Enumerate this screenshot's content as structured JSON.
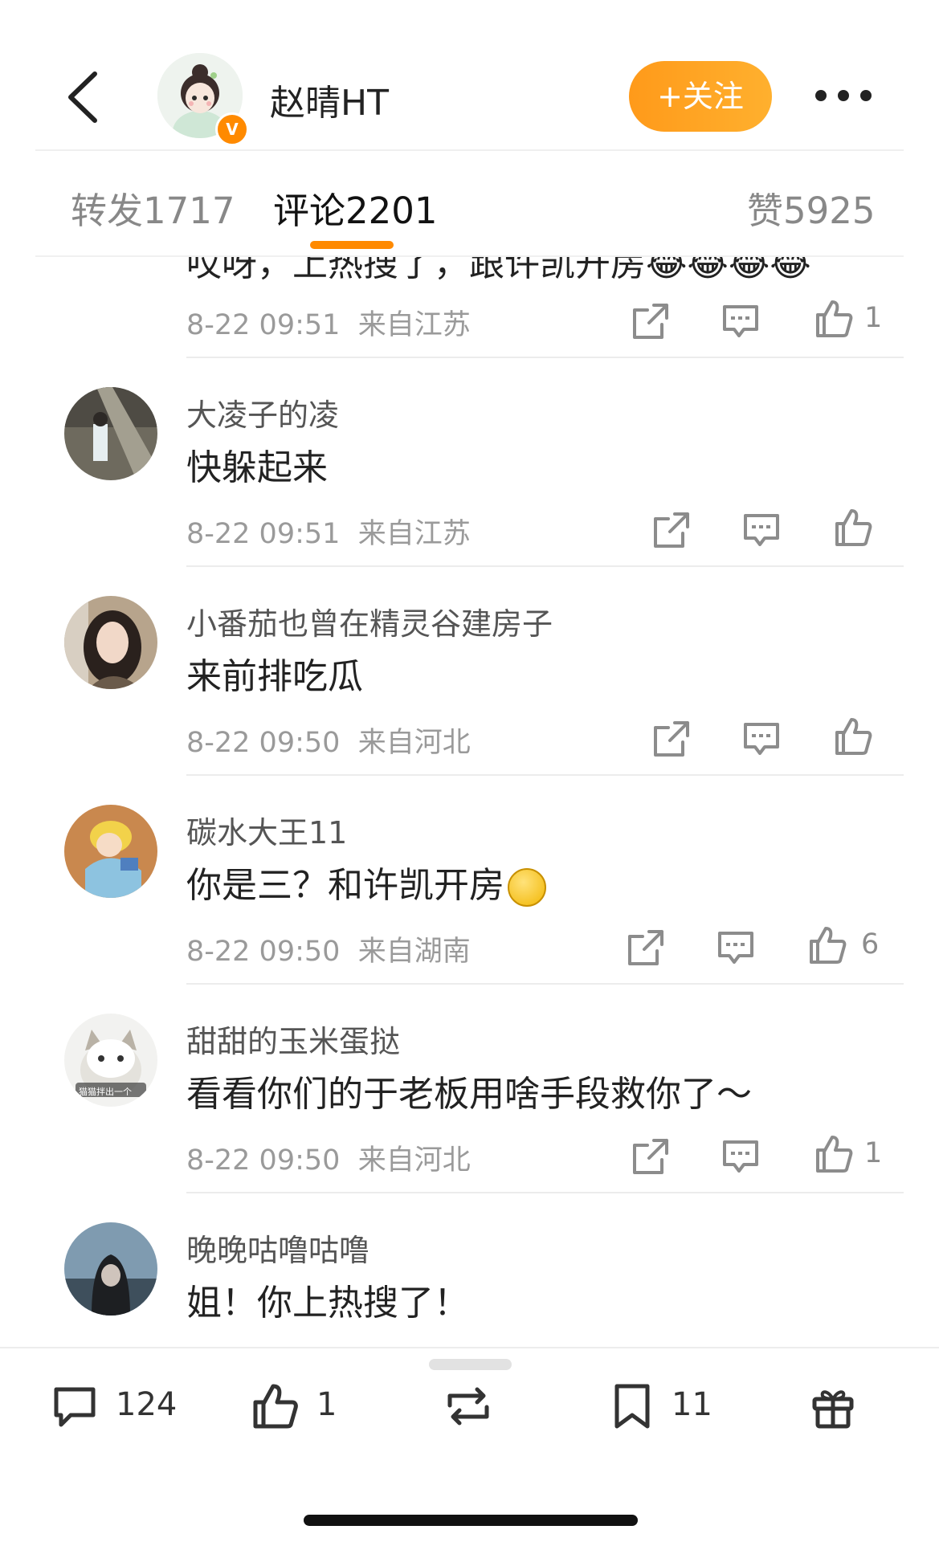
{
  "header": {
    "username": "赵晴HT",
    "verified_badge": "V",
    "follow_label": "+关注",
    "accent_color": "#ff9a1a"
  },
  "tabs": [
    {
      "label": "转发",
      "count": "1717"
    },
    {
      "label": "评论",
      "count": "2201",
      "active": true
    },
    {
      "label": "赞",
      "count": "5925"
    }
  ],
  "comments": [
    {
      "name": "",
      "text": "哎呀，上热搜了，跟许凯开房😂😂😂😂",
      "time": "8-22 09:51",
      "location": "来自江苏",
      "likes": "1"
    },
    {
      "name": "大凌子的凌",
      "text": "快躲起来",
      "time": "8-22 09:51",
      "location": "来自江苏",
      "likes": ""
    },
    {
      "name": "小番茄也曾在精灵谷建房子",
      "text": "来前排吃瓜",
      "time": "8-22 09:50",
      "location": "来自河北",
      "likes": ""
    },
    {
      "name": "碳水大王11",
      "text": "你是三？和许凯开房",
      "time": "8-22 09:50",
      "location": "来自湖南",
      "likes": "6"
    },
    {
      "name": "甜甜的玉米蛋挞",
      "text": "看看你们的于老板用啥手段救你了～",
      "time": "8-22 09:50",
      "location": "来自河北",
      "likes": "1"
    },
    {
      "name": "晚晚咕噜咕噜",
      "text": "姐！你上热搜了！",
      "time": "",
      "location": "",
      "likes": ""
    }
  ],
  "cat_avatar_caption": "猫猫拌出一个",
  "bottom_bar": {
    "comments_count": "124",
    "likes_count": "1",
    "favorites_count": "11"
  }
}
